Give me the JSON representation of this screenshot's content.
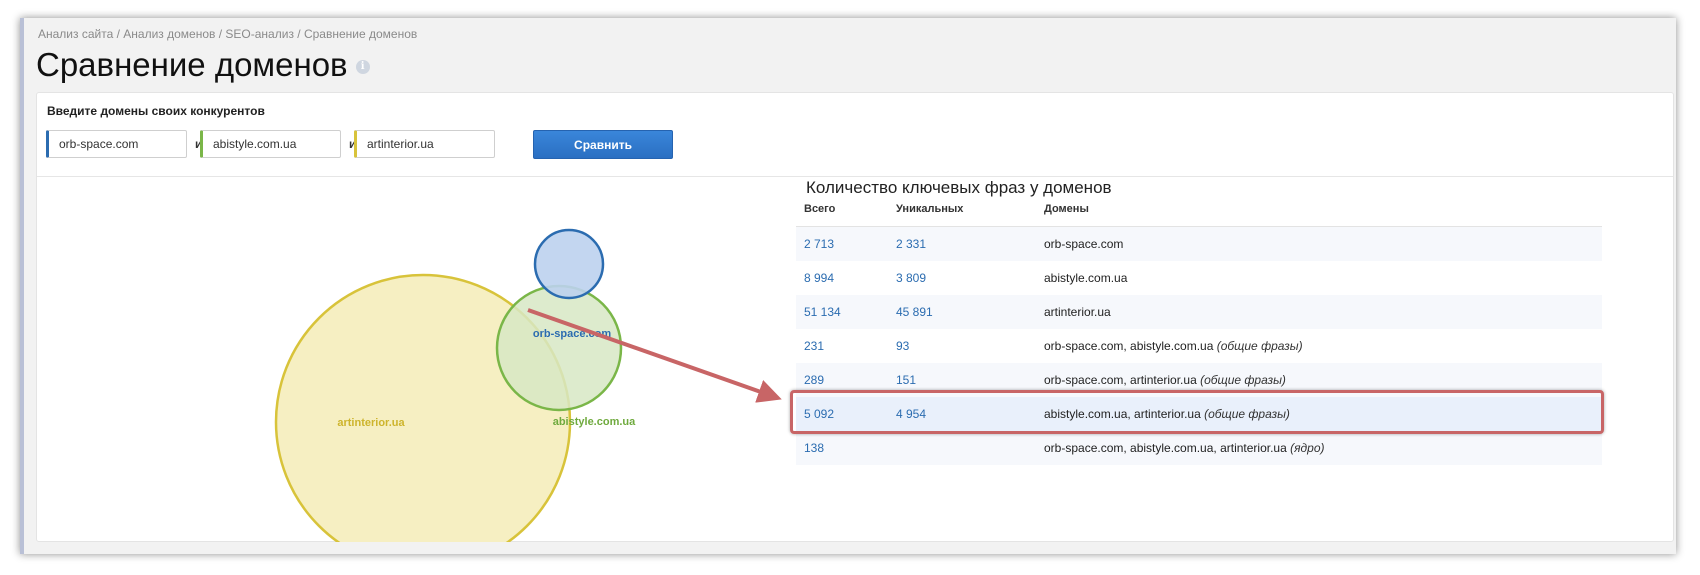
{
  "breadcrumb": {
    "items": [
      "Анализ сайта",
      "Анализ доменов",
      "SEO-анализ",
      "Сравнение доменов"
    ],
    "separator": " / "
  },
  "page": {
    "title": "Сравнение доменов",
    "info_glyph": "i"
  },
  "form": {
    "label": "Введите домены своих конкурентов",
    "domains": [
      {
        "value": "orb-space.com",
        "color": "#2b6cb0"
      },
      {
        "value": "abistyle.com.ua",
        "color": "#7ab648"
      },
      {
        "value": "artinterior.ua",
        "color": "#d8c33a"
      }
    ],
    "separator": "и",
    "compare_label": "Сравнить"
  },
  "venn": {
    "labels": {
      "orb": "orb-space.com",
      "abistyle": "abistyle.com.ua",
      "artinterior": "artinterior.ua"
    },
    "colors": {
      "orb_fill": "#bcd2ee",
      "orb_stroke": "#2b6cb0",
      "orb_text": "#2b6cb0",
      "abi_fill": "#d7e8c4",
      "abi_stroke": "#7ab648",
      "abi_text": "#6faa3e",
      "art_fill": "#f6efc2",
      "art_stroke": "#d8c33a",
      "art_text": "#cdb42c"
    }
  },
  "table": {
    "title": "Количество ключевых фраз у доменов",
    "headers": {
      "total": "Всего",
      "unique": "Уникальных",
      "domains": "Домены"
    },
    "rows": [
      {
        "total": "2 713",
        "unique": "2 331",
        "domains": "orb-space.com",
        "note": ""
      },
      {
        "total": "8 994",
        "unique": "3 809",
        "domains": "abistyle.com.ua",
        "note": ""
      },
      {
        "total": "51 134",
        "unique": "45 891",
        "domains": "artinterior.ua",
        "note": ""
      },
      {
        "total": "231",
        "unique": "93",
        "domains": "orb-space.com, abistyle.com.ua",
        "note": "(общие фразы)"
      },
      {
        "total": "289",
        "unique": "151",
        "domains": "orb-space.com, artinterior.ua",
        "note": "(общие фразы)"
      },
      {
        "total": "5 092",
        "unique": "4 954",
        "domains": "abistyle.com.ua, artinterior.ua",
        "note": "(общие фразы)"
      },
      {
        "total": "138",
        "unique": "",
        "domains": "orb-space.com, abistyle.com.ua, artinterior.ua",
        "note": "(ядро)"
      }
    ]
  },
  "annotation": {
    "color": "#c86566"
  }
}
